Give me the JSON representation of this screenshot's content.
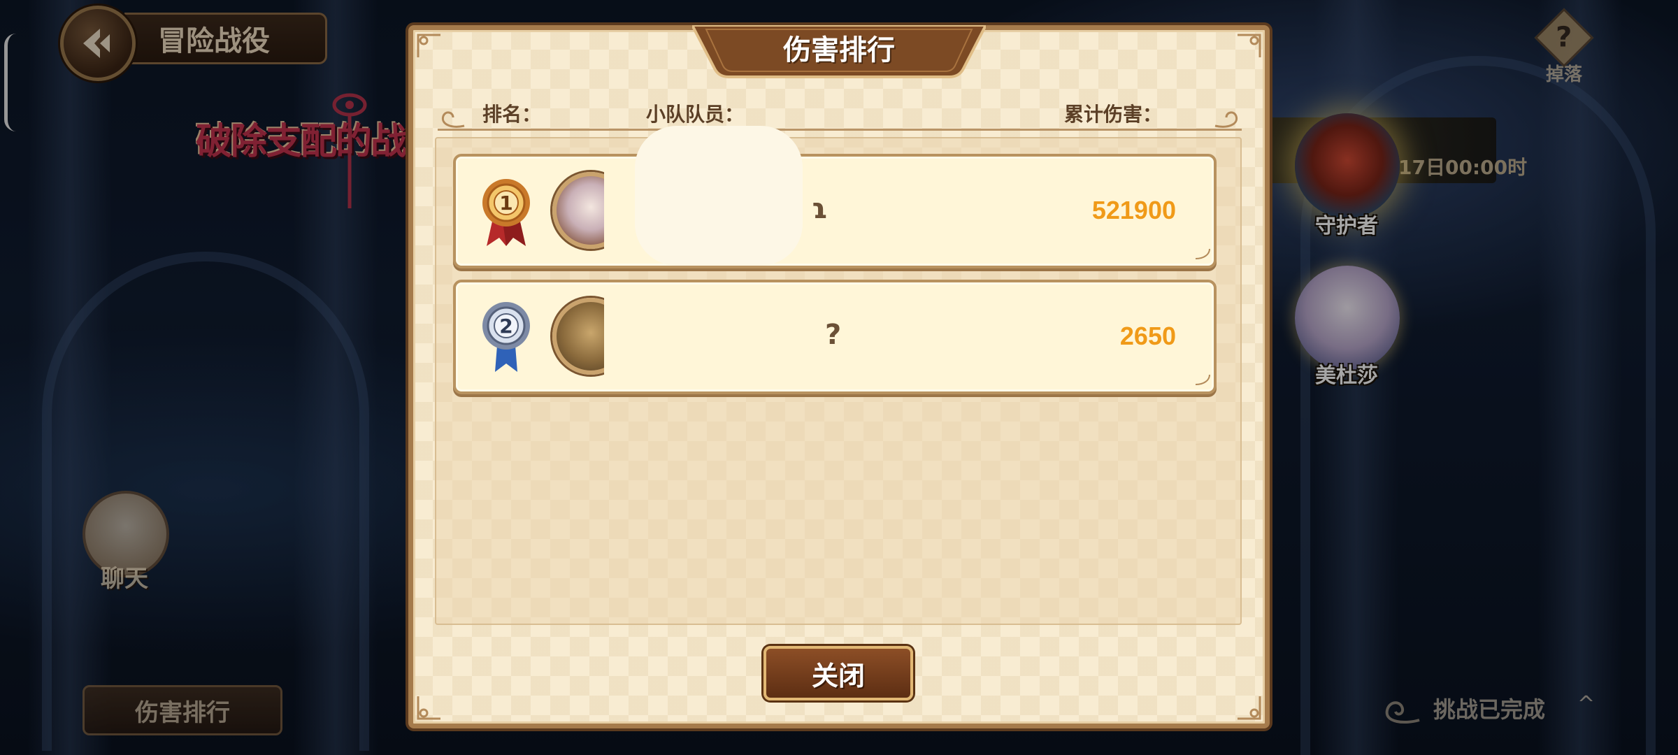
{
  "topbar": {
    "title": "冒险战役"
  },
  "event": {
    "banner_text": "破除支配的战役"
  },
  "left_panel": {
    "chat_label": "聊天",
    "damage_rank_button": "伤害排行"
  },
  "right_panel": {
    "drop_label": "掉落",
    "drop_icon_glyph": "?",
    "boss_strip_text": "17日00:00时",
    "bosses": [
      {
        "label": "守护者"
      },
      {
        "label": "美杜莎"
      }
    ],
    "challenge_status": "挑战已完成",
    "fold_glyph": "^"
  },
  "modal": {
    "title": "伤害排行",
    "headers": {
      "rank": "排名：",
      "members": "小队队员：",
      "damage": "累计伤害："
    },
    "rows": [
      {
        "rank": "1",
        "name_fragment": "ɿ",
        "damage": "521900"
      },
      {
        "rank": "2",
        "name_fragment": "?",
        "damage": "2650"
      }
    ],
    "close_label": "关闭"
  },
  "colors": {
    "damage_value": "#f09a18",
    "modal_bg": "#f8ecd2",
    "frame": "#a57b4c",
    "close_button": "#6e3a1a"
  }
}
